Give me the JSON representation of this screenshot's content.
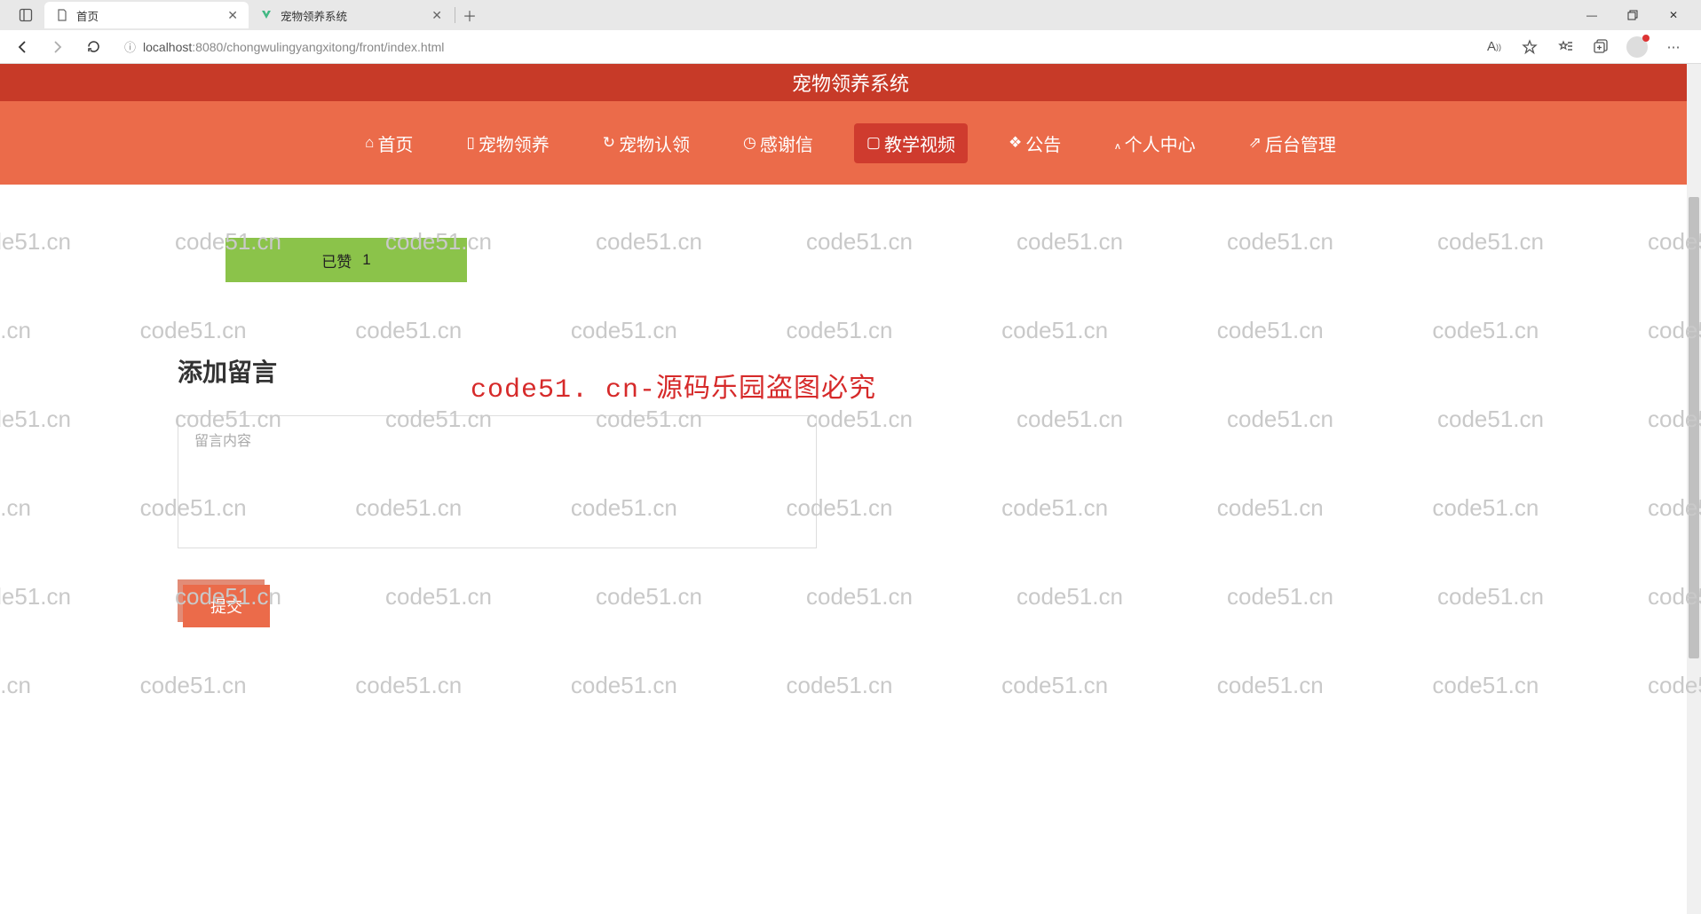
{
  "browser": {
    "tabs": [
      {
        "title": "首页",
        "active": true
      },
      {
        "title": "宠物领养系统",
        "active": false
      }
    ],
    "url_host": "localhost",
    "url_port": ":8080",
    "url_path": "/chongwulingyangxitong/front/index.html"
  },
  "banner": {
    "title": "宠物领养系统"
  },
  "nav": {
    "items": [
      {
        "icon": "⌂",
        "label": "首页"
      },
      {
        "icon": "▯",
        "label": "宠物领养"
      },
      {
        "icon": "↻",
        "label": "宠物认领"
      },
      {
        "icon": "◷",
        "label": "感谢信"
      },
      {
        "icon": "▢",
        "label": "教学视频",
        "active": true
      },
      {
        "icon": "❖",
        "label": "公告"
      },
      {
        "icon": "៱",
        "label": "个人中心"
      },
      {
        "icon": "⇗",
        "label": "后台管理"
      }
    ]
  },
  "like": {
    "label": "已赞",
    "count": "1"
  },
  "comment": {
    "title": "添加留言",
    "placeholder": "留言内容",
    "submit": "提交"
  },
  "watermark": {
    "text": "code51.cn",
    "big": "code51. cn-源码乐园盗图必究"
  }
}
